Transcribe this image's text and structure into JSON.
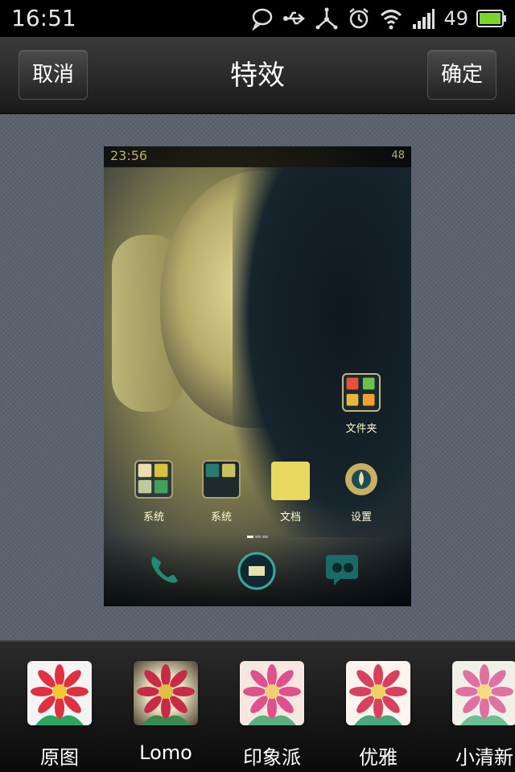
{
  "status_bar": {
    "time": "16:51",
    "battery_level": "49",
    "icons": [
      "chat-bubble-icon",
      "usb-icon",
      "tethering-icon",
      "alarm-icon",
      "wifi-icon",
      "signal-icon",
      "battery-icon"
    ]
  },
  "header": {
    "cancel_label": "取消",
    "title": "特效",
    "confirm_label": "确定"
  },
  "preview": {
    "status_time": "23:56",
    "status_battery": "48",
    "folder_top_label": "文件夹",
    "apps": [
      {
        "label": "系统",
        "icon": "system-folder-icon"
      },
      {
        "label": "系统",
        "icon": "system-folder-2-icon"
      },
      {
        "label": "文档",
        "icon": "documents-folder-icon"
      },
      {
        "label": "设置",
        "icon": "settings-icon"
      }
    ],
    "dock": [
      "phone-icon",
      "launcher-icon",
      "messages-icon"
    ]
  },
  "filters": [
    {
      "label": "原图",
      "selected": true
    },
    {
      "label": "Lomo"
    },
    {
      "label": "印象派"
    },
    {
      "label": "优雅"
    },
    {
      "label": "小清新"
    }
  ],
  "colors": {
    "header_bg": "#2a2a2a",
    "preview_bg": "#5a626e",
    "battery_green": "#7bd32d"
  }
}
